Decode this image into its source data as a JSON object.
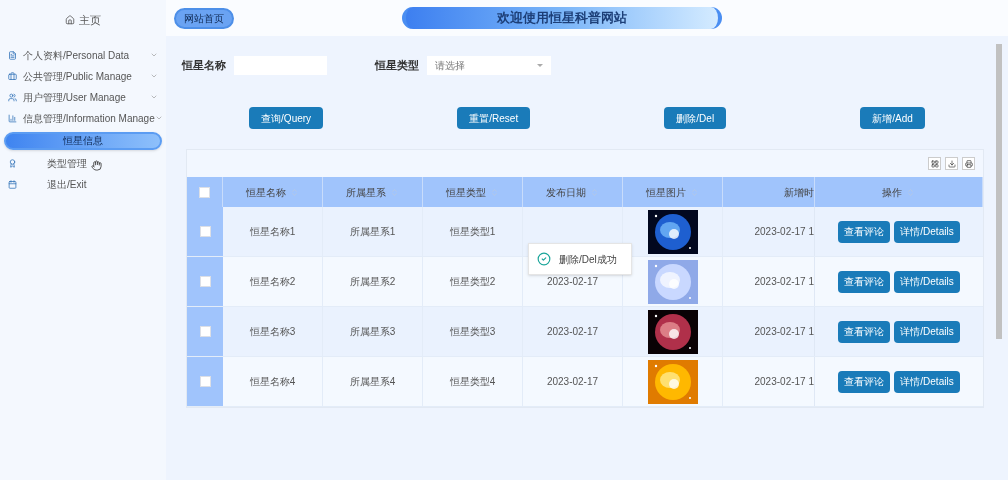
{
  "sidebar": {
    "home": "主页",
    "items": [
      {
        "kind": "menu",
        "label": "个人资料/Personal Data"
      },
      {
        "kind": "menu",
        "label": "公共管理/Public Manage"
      },
      {
        "kind": "menu",
        "label": "用户管理/User Manage"
      },
      {
        "kind": "menu",
        "label": "信息管理/Information Manage",
        "children": [
          {
            "label": "恒星信息",
            "selected": true
          }
        ]
      },
      {
        "kind": "link",
        "label": "类型管理"
      },
      {
        "kind": "link",
        "label": "退出/Exit"
      }
    ]
  },
  "header": {
    "breadcrumb": "网站首页",
    "title": "欢迎使用恒星科普网站"
  },
  "search": {
    "fields": [
      {
        "kind": "text",
        "label": "恒星名称"
      },
      {
        "kind": "select",
        "label": "恒星类型",
        "placeholder": "请选择"
      }
    ],
    "buttons": [
      "查询/Query",
      "重置/Reset",
      "删除/Del",
      "新增/Add"
    ]
  },
  "toast": {
    "text": "删除/Del成功"
  },
  "table": {
    "select_all": {
      "checked": false
    },
    "columns": [
      {
        "label": "恒星名称",
        "sortable": true
      },
      {
        "label": "所属星系",
        "sortable": true
      },
      {
        "label": "恒星类型",
        "sortable": true
      },
      {
        "label": "发布日期",
        "sortable": true
      },
      {
        "label": "恒星图片",
        "sortable": true
      },
      {
        "label": "新增时",
        "sortable": false
      },
      {
        "label": "操作",
        "sortable": true
      }
    ],
    "rows": [
      {
        "checked": false,
        "name": "恒星名称1",
        "galaxy": "所属星系1",
        "type": "恒星类型1",
        "time": "2023-02-17 1",
        "actions": [
          "查看评论",
          "详情/Details"
        ]
      },
      {
        "checked": false,
        "name": "恒星名称2",
        "galaxy": "所属星系2",
        "type": "恒星类型2",
        "date": "2023-02-17",
        "time": "2023-02-17 1",
        "actions": [
          "查看评论",
          "详情/Details"
        ]
      },
      {
        "checked": false,
        "name": "恒星名称3",
        "galaxy": "所属星系3",
        "type": "恒星类型3",
        "date": "2023-02-17",
        "time": "2023-02-17 1",
        "actions": [
          "查看评论",
          "详情/Details"
        ]
      },
      {
        "checked": false,
        "name": "恒星名称4",
        "galaxy": "所属星系4",
        "type": "恒星类型4",
        "date": "2023-02-17",
        "time": "2023-02-17 1",
        "actions": [
          "查看评论",
          "详情/Details"
        ]
      }
    ]
  }
}
